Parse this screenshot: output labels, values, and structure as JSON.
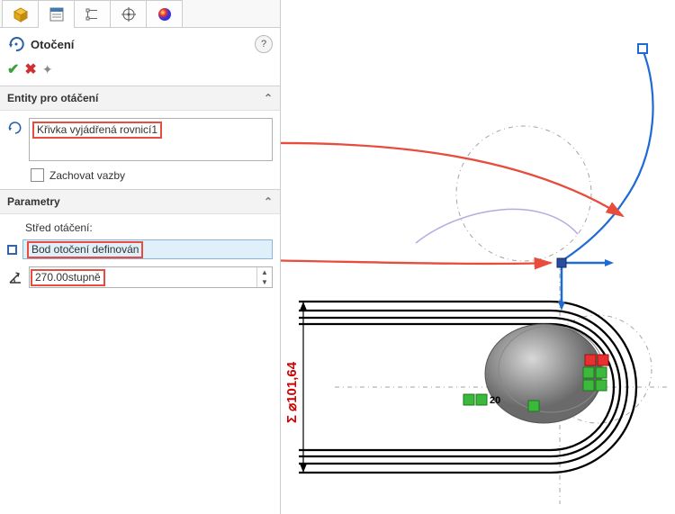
{
  "feature": {
    "title": "Otočení"
  },
  "sections": {
    "entities": {
      "header": "Entity pro otáčení",
      "item0": "Křivka vyjádřená rovnicí1",
      "keep_constraints": "Zachovat vazby"
    },
    "params": {
      "header": "Parametry",
      "center_label": "Střed otáčení:",
      "center_value": "Bod otočení definován",
      "angle_value": "270.00stupně"
    }
  },
  "viewport": {
    "dim_value": "101,64",
    "annotation_value": "20"
  }
}
